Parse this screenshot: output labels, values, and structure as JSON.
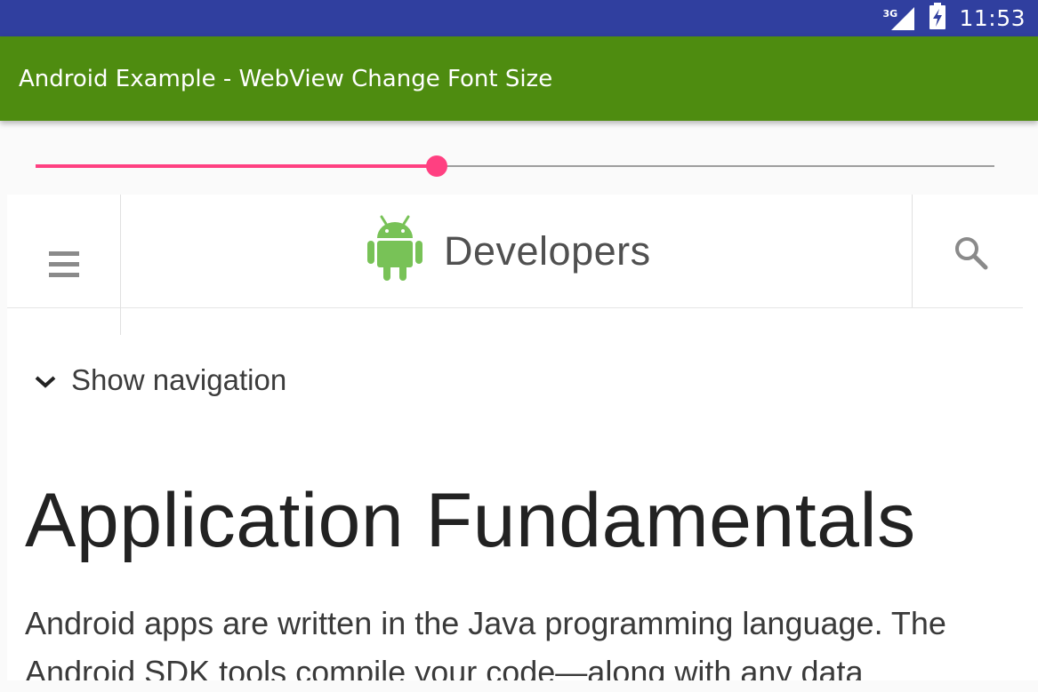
{
  "status_bar": {
    "network_type": "3G",
    "signal_icon": "cell-signal-icon",
    "battery_icon": "battery-charging-icon",
    "time": "11:53",
    "background_color": "#303f9f"
  },
  "action_bar": {
    "title": "Android Example - WebView Change Font Size",
    "background_color": "#4e8c10"
  },
  "seekbar": {
    "progress_fraction": 0.418,
    "accent_color": "#ff4081",
    "track_color": "#9e9e9e"
  },
  "webview": {
    "header": {
      "menu_icon": "hamburger-menu-icon",
      "logo_icon": "android-robot-icon",
      "brand_text": "Developers",
      "search_icon": "search-icon",
      "logo_color": "#78c257"
    },
    "nav_toggle": {
      "icon": "chevron-down-icon",
      "label": "Show navigation"
    },
    "heading": "Application Fundamentals",
    "body_text": "Android apps are written in the Java programming language. The Android SDK tools compile your code—along with any data"
  }
}
